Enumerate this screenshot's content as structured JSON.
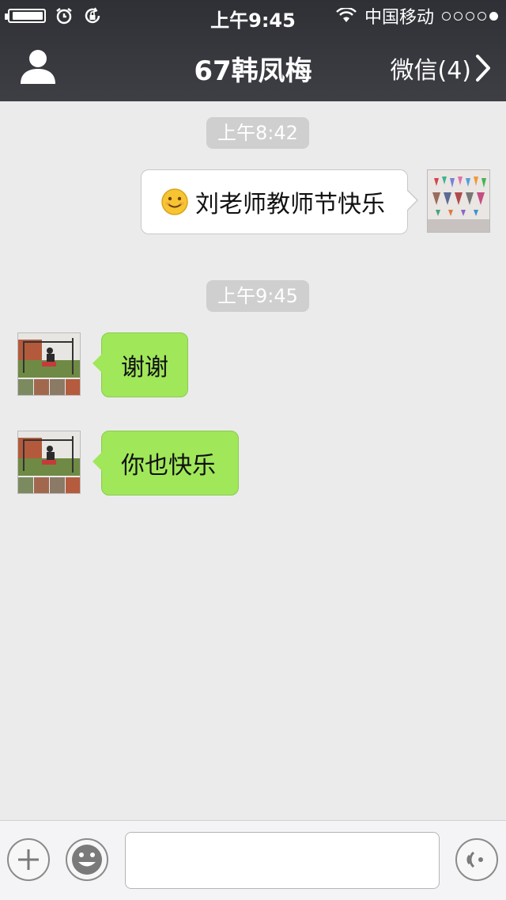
{
  "status_bar": {
    "time": "上午9:45",
    "carrier": "中国移动",
    "signal_dots_filled": 1,
    "signal_dots_total": 5
  },
  "nav": {
    "title": "67韩凤梅",
    "back_label": "微信(4)"
  },
  "messages": [
    {
      "type": "time",
      "text": "上午8:42"
    },
    {
      "type": "outgoing",
      "text": "刘老师教师节快乐",
      "emoji": "smiley"
    },
    {
      "type": "time",
      "text": "上午9:45"
    },
    {
      "type": "incoming",
      "text": "谢谢"
    },
    {
      "type": "incoming",
      "text": "你也快乐"
    }
  ],
  "input": {
    "placeholder": ""
  },
  "colors": {
    "header": "#35363b",
    "chat_bg": "#ebebeb",
    "incoming_bubble": "#a0e75a",
    "outgoing_bubble": "#ffffff",
    "time_pill": "#cfcfcf"
  }
}
